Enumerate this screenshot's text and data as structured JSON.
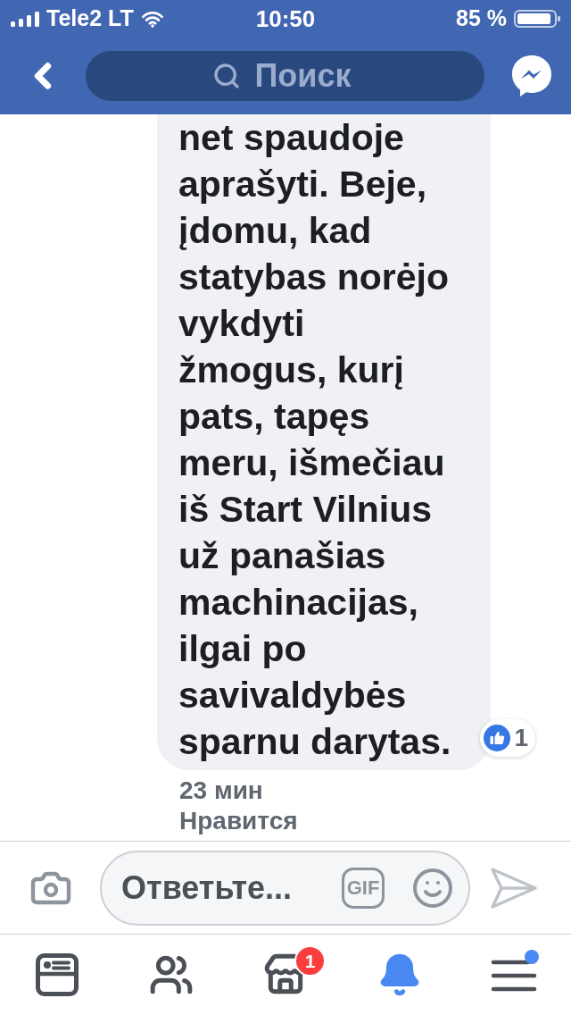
{
  "status_bar": {
    "carrier": "Tele2 LT",
    "time": "10:50",
    "battery": "85 %"
  },
  "nav": {
    "search": {
      "placeholder": "Поиск"
    }
  },
  "comment": {
    "text": "net spaudoje\naprašyti. Beje,\nįdomu, kad\nstatybas norėjo\nvykdyti\nžmogus, kurį\npats, tapęs\nmeru, išmečiau\niš Start Vilnius\nuž panašias\nmachinacijas,\nilgai po\nsavivaldybės\nsparnu darytas.",
    "reaction_count": "1",
    "time": "23 мин",
    "actions": [
      "Нравится"
    ]
  },
  "composer": {
    "placeholder": "Ответьте...",
    "gif_label": "GIF"
  },
  "tab_bar": [
    {
      "kind": "news_feed",
      "selected": false,
      "dot": false
    },
    {
      "kind": "friends",
      "selected": false,
      "dot": false
    },
    {
      "kind": "marketplace",
      "selected": false,
      "dot": false,
      "badge": "1"
    },
    {
      "kind": "notifications",
      "selected": true,
      "dot": false
    },
    {
      "kind": "menu",
      "selected": false,
      "dot": true
    }
  ]
}
